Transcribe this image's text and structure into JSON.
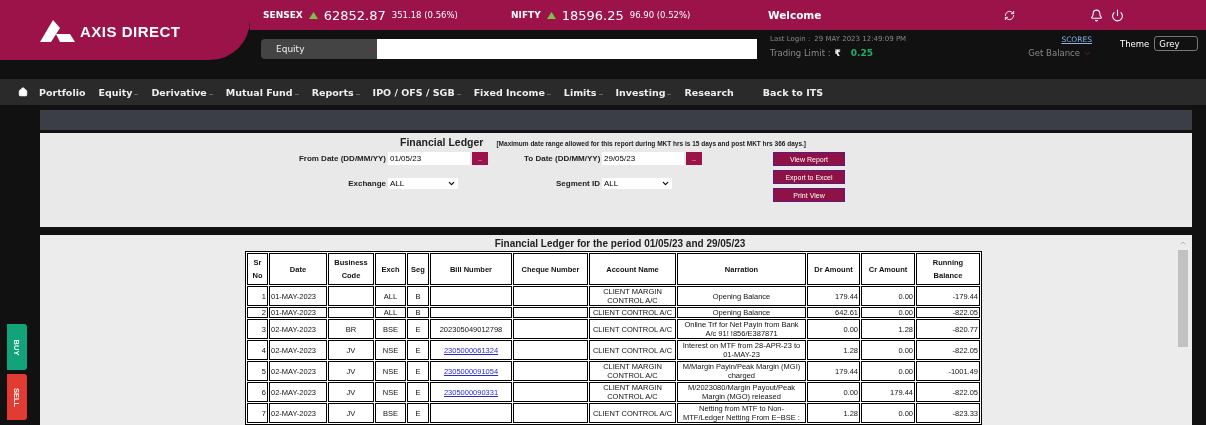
{
  "header": {
    "logo": "AXIS DIRECT",
    "tickers": [
      {
        "name": "SENSEX",
        "up": true,
        "value": "62852.87",
        "change": "351.18 (0.56%)"
      },
      {
        "name": "NIFTY",
        "up": true,
        "value": "18596.25",
        "change": "96.90 (0.52%)"
      }
    ],
    "welcome": "Welcome",
    "search": {
      "segment": "Equity"
    },
    "last_login_label": "Last Login :",
    "last_login": "29 MAY 2023 12:49:09 PM",
    "trading_limit_label": "Trading Limit :",
    "currency": "₹",
    "trading_limit": "0.25",
    "scores_link": "SCORES",
    "get_balance": "Get Balance",
    "theme_label": "Theme",
    "theme": "Grey"
  },
  "nav": [
    {
      "label": "Portfolio",
      "has_menu": false
    },
    {
      "label": "Equity",
      "has_menu": true
    },
    {
      "label": "Derivative",
      "has_menu": true
    },
    {
      "label": "Mutual Fund",
      "has_menu": true
    },
    {
      "label": "Reports",
      "has_menu": true
    },
    {
      "label": "IPO / OFS / SGB",
      "has_menu": true
    },
    {
      "label": "Fixed Income",
      "has_menu": true
    },
    {
      "label": "Limits",
      "has_menu": true
    },
    {
      "label": "Investing",
      "has_menu": true
    },
    {
      "label": "Research",
      "has_menu": false
    },
    {
      "label": "Back to ITS",
      "has_menu": false
    }
  ],
  "side_tabs": [
    "BUY",
    "SELL"
  ],
  "form": {
    "title": "Financial Ledger",
    "note": "[Maximum date range allowed for this report during MKT hrs is 15 days and post MKT hrs 366 days.]",
    "from_label": "From Date (DD/MM/YY)",
    "from_date": "01/05/23",
    "picker": "..",
    "to_label": "To Date (DD/MM/YY)",
    "to_date": "29/05/23",
    "exchange_label": "Exchange",
    "exchange": "ALL",
    "segment_label": "Segment ID",
    "segment": "ALL",
    "buttons": [
      "View Report",
      "Export to Excel",
      "Print View"
    ]
  },
  "table": {
    "title": "Financial Ledger for the period 01/05/23 and 29/05/23",
    "columns": [
      "Sr No",
      "Date",
      "Business Code",
      "Exch",
      "Seg",
      "Bill Number",
      "Cheque Number",
      "Account Name",
      "Narration",
      "Dr Amount",
      "Cr Amount",
      "Running Balance"
    ],
    "rows": [
      {
        "sr": "1",
        "date": "01-MAY-2023",
        "exch": "ALL",
        "seg": "B",
        "account": "CLIENT MARGIN CONTROL A/C",
        "narration": "Opening Balance",
        "dr": "179.44",
        "cr": "0.00",
        "balance": "-179.44"
      },
      {
        "sr": "2",
        "date": "01-MAY-2023",
        "exch": "ALL",
        "seg": "B",
        "account": "CLIENT CONTROL A/C",
        "narration": "Opening Balance",
        "dr": "642.61",
        "cr": "0.00",
        "balance": "-822.05"
      },
      {
        "sr": "3",
        "date": "02-MAY-2023",
        "code": "BR",
        "exch": "BSE",
        "seg": "E",
        "bill": "202305049012798",
        "bill_link": false,
        "account": "CLIENT CONTROL A/C",
        "narration": "Online Trf for Net Payin from Bank A/c 91!             !856/E387871",
        "dr": "0.00",
        "cr": "1.28",
        "balance": "-820.77"
      },
      {
        "sr": "4",
        "date": "02-MAY-2023",
        "code": "JV",
        "exch": "NSE",
        "seg": "E",
        "bill": "2305000061324",
        "bill_link": true,
        "account": "CLIENT CONTROL A/C",
        "narration": "Interest on MTF from 28-APR-23 to 01-MAY-23",
        "dr": "1.28",
        "cr": "0.00",
        "balance": "-822.05"
      },
      {
        "sr": "5",
        "date": "02-MAY-2023",
        "code": "JV",
        "exch": "NSE",
        "seg": "E",
        "bill": "2305000091054",
        "bill_link": true,
        "account": "CLIENT MARGIN CONTROL A/C",
        "narration": "M/Margin Payin/Peak Margin (MGI) charged",
        "dr": "179.44",
        "cr": "0.00",
        "balance": "-1001.49"
      },
      {
        "sr": "6",
        "date": "02-MAY-2023",
        "code": "JV",
        "exch": "NSE",
        "seg": "E",
        "bill": "2305000090331",
        "bill_link": true,
        "account": "CLIENT MARGIN CONTROL A/C",
        "narration": "M/2023080/Margin Payout/Peak Margin (MGO) released",
        "dr": "0.00",
        "cr": "179.44",
        "balance": "-822.05"
      },
      {
        "sr": "7",
        "date": "02-MAY-2023",
        "code": "JV",
        "exch": "BSE",
        "seg": "E",
        "account": "CLIENT CONTROL A/C",
        "narration": "Netting from MTF to Non-MTF/Ledger Netting From E~BSE :",
        "dr": "1.28",
        "cr": "0.00",
        "balance": "-823.33"
      }
    ]
  }
}
